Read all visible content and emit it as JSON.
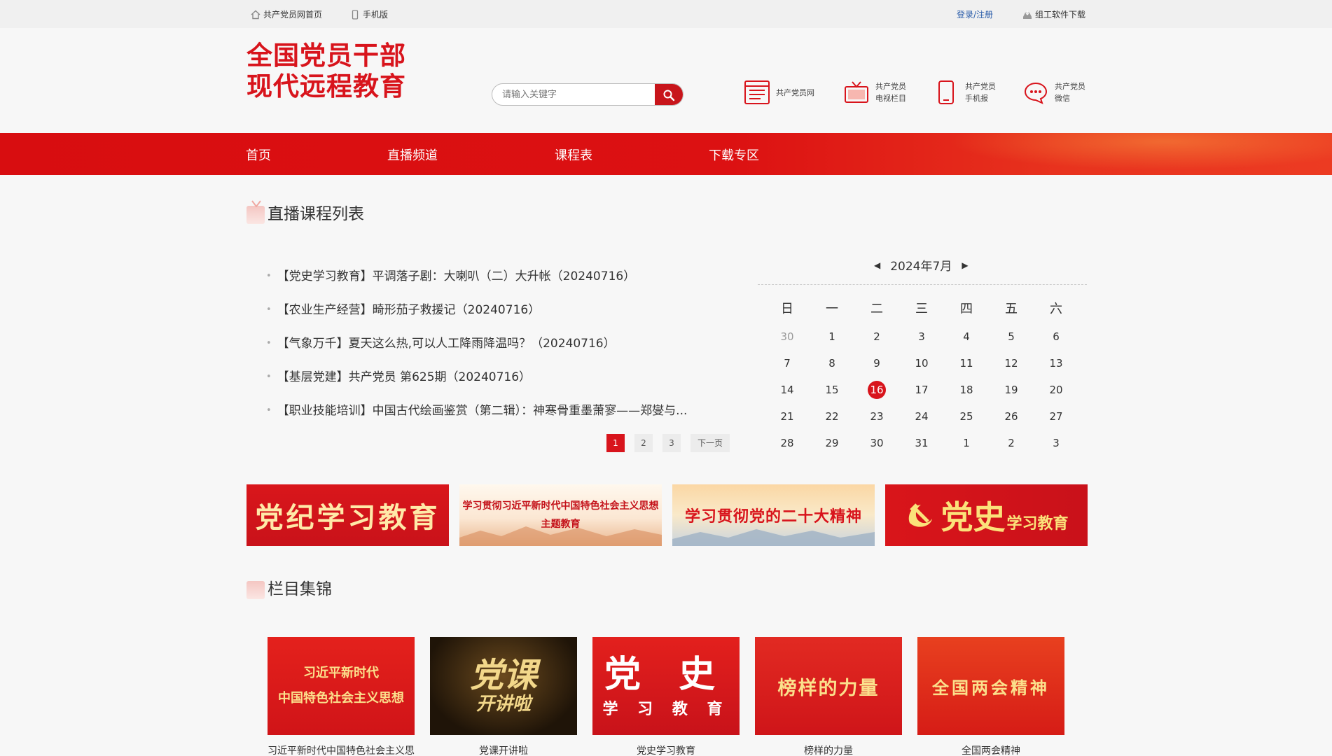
{
  "topbar": {
    "home_link": "共产党员网首页",
    "mobile_link": "手机版",
    "login_link": "登录/注册",
    "software_link": "组工软件下载"
  },
  "header": {
    "logo_line1": "全国党员干部",
    "logo_line2": "现代远程教育",
    "search_placeholder": "请输入关键字",
    "links": [
      {
        "label": "共产党员网",
        "icon": "web-page-icon"
      },
      {
        "label": "共产党员\n电视栏目",
        "icon": "tv-icon"
      },
      {
        "label": "共产党员\n手机报",
        "icon": "phone-icon"
      },
      {
        "label": "共产党员\n微信",
        "icon": "wechat-icon"
      }
    ]
  },
  "nav": {
    "items": [
      "首页",
      "直播频道",
      "课程表",
      "下载专区"
    ]
  },
  "live": {
    "title": "直播课程列表",
    "courses": [
      "【党史学习教育】平调落子剧：大喇叭（二）大升帐（20240716）",
      "【农业生产经营】畸形茄子救援记（20240716）",
      "【气象万千】夏天这么热,可以人工降雨降温吗？（20240716）",
      "【基层党建】共产党员 第625期（20240716）",
      "【职业技能培训】中国古代绘画鉴赏（第二辑）：神寒骨重墨萧寥——郑燮与..."
    ],
    "pager": {
      "pages": [
        "1",
        "2",
        "3"
      ],
      "current": "1",
      "next": "下一页"
    }
  },
  "calendar": {
    "month_label": "2024年7月",
    "weekdays": [
      "日",
      "一",
      "二",
      "三",
      "四",
      "五",
      "六"
    ],
    "days": [
      {
        "d": "30",
        "muted": true
      },
      {
        "d": "1"
      },
      {
        "d": "2"
      },
      {
        "d": "3"
      },
      {
        "d": "4"
      },
      {
        "d": "5"
      },
      {
        "d": "6"
      },
      {
        "d": "7"
      },
      {
        "d": "8"
      },
      {
        "d": "9"
      },
      {
        "d": "10"
      },
      {
        "d": "11"
      },
      {
        "d": "12"
      },
      {
        "d": "13"
      },
      {
        "d": "14"
      },
      {
        "d": "15"
      },
      {
        "d": "16",
        "today": true
      },
      {
        "d": "17"
      },
      {
        "d": "18"
      },
      {
        "d": "19"
      },
      {
        "d": "20"
      },
      {
        "d": "21"
      },
      {
        "d": "22"
      },
      {
        "d": "23"
      },
      {
        "d": "24"
      },
      {
        "d": "25"
      },
      {
        "d": "26"
      },
      {
        "d": "27"
      },
      {
        "d": "28"
      },
      {
        "d": "29"
      },
      {
        "d": "30"
      },
      {
        "d": "31"
      },
      {
        "d": "1"
      },
      {
        "d": "2"
      },
      {
        "d": "3"
      }
    ]
  },
  "banners": {
    "b1": "党纪学习教育",
    "b2_line1": "学习贯彻习近平新时代中国特色社会主义思想",
    "b2_line2": "主题教育",
    "b3": "学习贯彻党的二十大精神",
    "b4_main": "党史",
    "b4_sub": "学习教育"
  },
  "columns": {
    "title": "栏目集锦",
    "items": [
      {
        "art_line1": "习近平新时代",
        "art_line2": "中国特色社会主义思想",
        "caption": "习近平新时代中国特色社会主义思"
      },
      {
        "art_line1": "党课",
        "art_line2": "开讲啦",
        "caption": "党课开讲啦"
      },
      {
        "art_line1": "党 史",
        "art_line2": "学 习 教 育",
        "caption": "党史学习教育"
      },
      {
        "art_line1": "榜样的力量",
        "caption": "榜样的力量"
      },
      {
        "art_line1": "全国两会精神",
        "caption": "全国两会精神"
      }
    ]
  },
  "colors": {
    "brand_red": "#d8141c",
    "link_blue": "#2a5daa"
  }
}
